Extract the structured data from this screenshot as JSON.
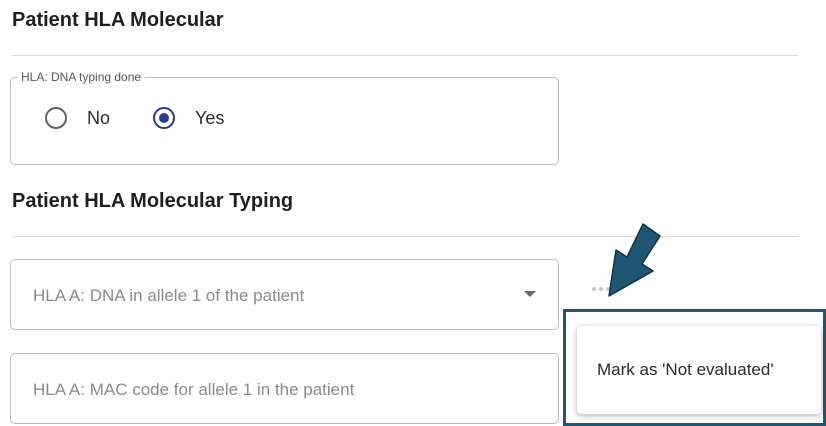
{
  "section1": {
    "title": "Patient HLA Molecular"
  },
  "dna_typing": {
    "legend": "HLA: DNA typing done",
    "options": [
      {
        "label": "No",
        "selected": false
      },
      {
        "label": "Yes",
        "selected": true
      }
    ]
  },
  "section2": {
    "title": "Patient HLA Molecular Typing"
  },
  "fields": {
    "allele1_dna": {
      "placeholder": "HLA A: DNA in allele 1 of the patient"
    },
    "allele1_mac": {
      "placeholder": "HLA A: MAC code for allele 1 in the patient"
    }
  },
  "context_menu": {
    "items": [
      {
        "label": "Mark as 'Not evaluated'"
      }
    ]
  },
  "colors": {
    "radio_accent": "#2b3a8c",
    "highlight_border": "#1f5673",
    "arrow_fill": "#1f5673"
  },
  "icons": {
    "more": "more-horizontal-icon",
    "dropdown": "chevron-down-icon",
    "pointer": "arrow-pointer-icon"
  }
}
